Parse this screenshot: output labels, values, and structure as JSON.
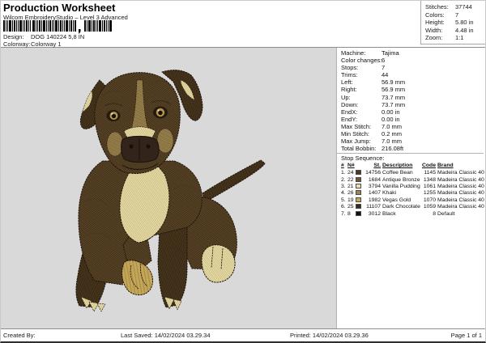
{
  "header": {
    "title": "Production Worksheet",
    "subtitle": "Wilcom EmbroideryStudio – Level 3 Advanced",
    "design_label": "Design:",
    "design_value": "DOG 140224 5,8 IN",
    "colorway_label": "Colorway:",
    "colorway_value": "Colorway 1",
    "stats": [
      {
        "label": "Stitches:",
        "value": "37744"
      },
      {
        "label": "Colors:",
        "value": "7"
      },
      {
        "label": "Height:",
        "value": "5.80 in"
      },
      {
        "label": "Width:",
        "value": "4.48 in"
      },
      {
        "label": "Zoom:",
        "value": "1:1"
      }
    ]
  },
  "machine_info": [
    {
      "label": "Machine:",
      "value": "Tajima"
    },
    {
      "label": "Color changes:",
      "value": "6"
    },
    {
      "label": "Stops:",
      "value": "7"
    },
    {
      "label": "Trims:",
      "value": "44"
    },
    {
      "label": "Left:",
      "value": "56.9 mm"
    },
    {
      "label": "Right:",
      "value": "56.9 mm"
    },
    {
      "label": "Up:",
      "value": "73.7 mm"
    },
    {
      "label": "Down:",
      "value": "73.7 mm"
    },
    {
      "label": "EndX:",
      "value": "0.00 in"
    },
    {
      "label": "EndY:",
      "value": "0.00 in"
    },
    {
      "label": "Max Stitch:",
      "value": "7.0 mm"
    },
    {
      "label": "Min Stitch:",
      "value": "0.2 mm"
    },
    {
      "label": "Max Jump:",
      "value": "7.0 mm"
    },
    {
      "label": "Total Bobbin:",
      "value": "216.08ft"
    }
  ],
  "stop_sequence": {
    "heading": "Stop Sequence:",
    "columns": [
      "#",
      "N#",
      "St.",
      "Description",
      "Code",
      "Brand"
    ],
    "rows": [
      {
        "num": "1.",
        "needle": "24",
        "color": "#4a3824",
        "stitches": "14756",
        "description": "Coffee Bean",
        "code": "1145",
        "brand": "Madeira Classic 40"
      },
      {
        "num": "2.",
        "needle": "22",
        "color": "#6f5733",
        "stitches": "1684",
        "description": "Antique Bronze",
        "code": "1348",
        "brand": "Madeira Classic 40"
      },
      {
        "num": "3.",
        "needle": "21",
        "color": "#eadfae",
        "stitches": "3794",
        "description": "Vanilla Pudding",
        "code": "1061",
        "brand": "Madeira Classic 40"
      },
      {
        "num": "4.",
        "needle": "26",
        "color": "#9a8453",
        "stitches": "1407",
        "description": "Khaki",
        "code": "1255",
        "brand": "Madeira Classic 40"
      },
      {
        "num": "5.",
        "needle": "19",
        "color": "#c7a952",
        "stitches": "1982",
        "description": "Vegas Gold",
        "code": "1070",
        "brand": "Madeira Classic 40"
      },
      {
        "num": "6.",
        "needle": "25",
        "color": "#3a2a19",
        "stitches": "11107",
        "description": "Dark Chocolate",
        "code": "1059",
        "brand": "Madeira Classic 40"
      },
      {
        "num": "7.",
        "needle": "8",
        "color": "#111111",
        "stitches": "3012",
        "description": "Black",
        "code": "8",
        "brand": "Default"
      }
    ]
  },
  "footer": {
    "created_by": "Created By:",
    "last_saved": "Last Saved: 14/02/2024 03.29.34",
    "printed": "Printed: 14/02/2024 03.29.36",
    "page": "Page 1 of 1"
  }
}
